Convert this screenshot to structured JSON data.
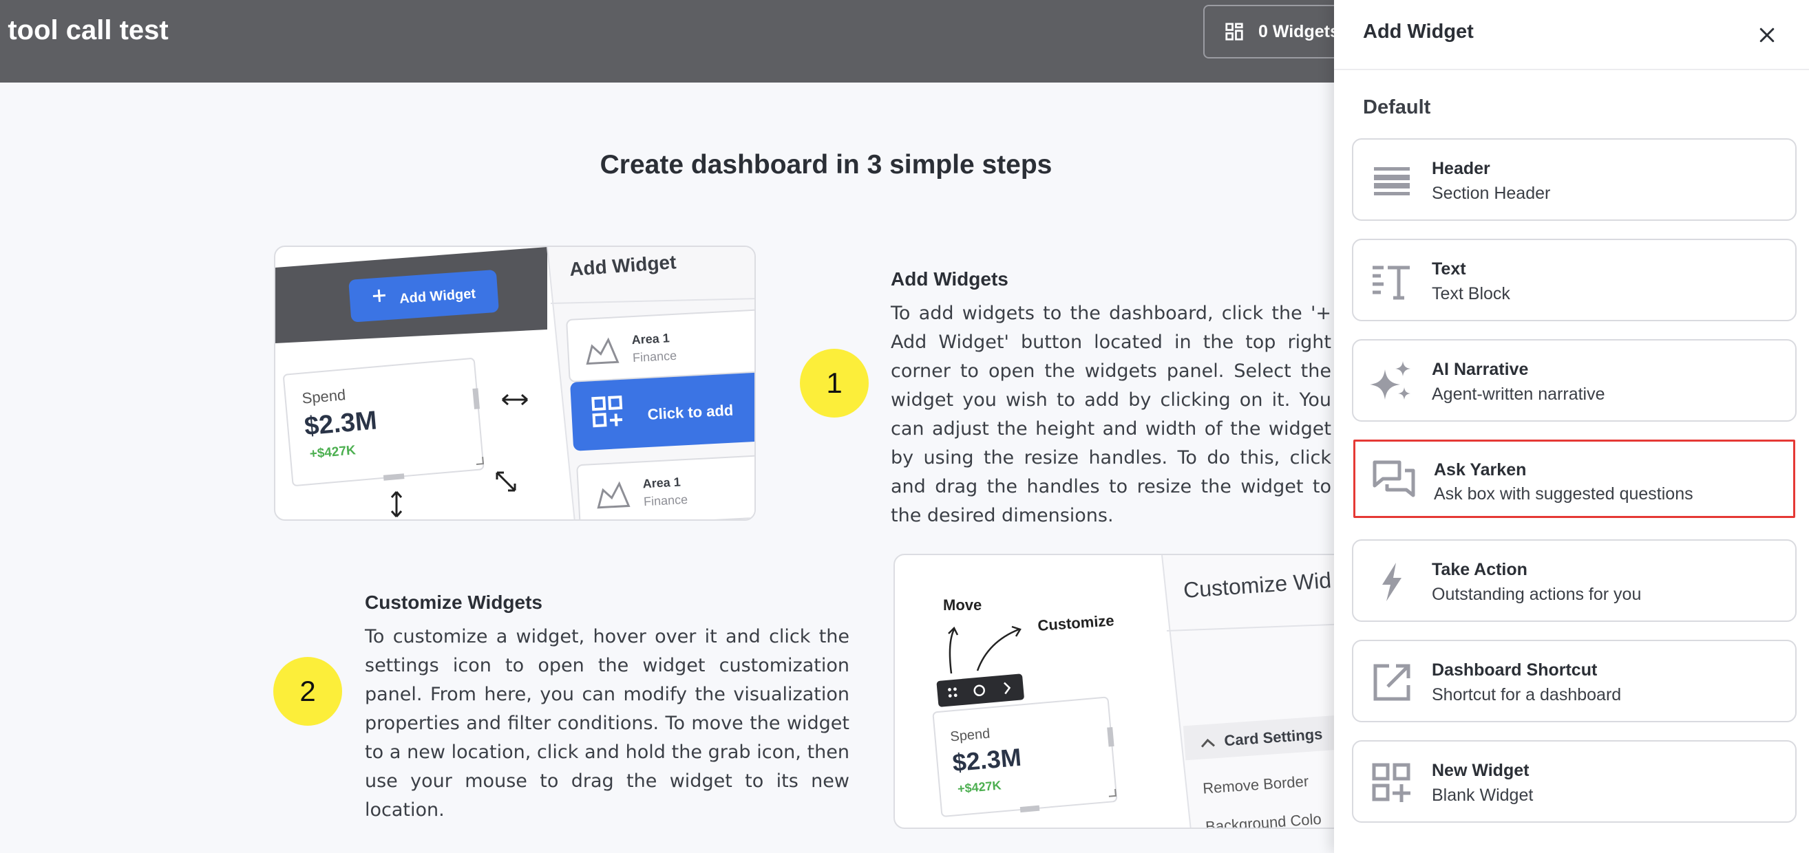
{
  "header": {
    "title": "e tool call test",
    "widgets_button": "0 Widgets"
  },
  "main": {
    "heading": "Create dashboard in 3 simple steps",
    "steps": [
      {
        "number": "1",
        "title": "Add Widgets",
        "body": "To add widgets to the dashboard, click the '+ Add Widget' button located in the top right corner to open the widgets panel. Select the widget you wish to add by clicking on it. You can adjust the height and width of the widget by using the resize handles. To do this, click and drag the handles to resize the widget to the desired dimensions."
      },
      {
        "number": "2",
        "title": "Customize Widgets",
        "body": "To customize a widget, hover over it and click the settings icon to open the widget customization panel. From here, you can modify the visualization properties and filter conditions. To move the widget to a new location, click and hold the grab icon, then use your mouse to drag the widget to its new location."
      }
    ],
    "illustration1": {
      "add_widget_button": "Add Widget",
      "panel_title": "Add Widget",
      "card_title": "Spend",
      "card_value": "$2.3M",
      "card_delta": "+$427K",
      "item1_title": "Area 1",
      "item1_sub": "Finance",
      "click_to_add": "Click to add",
      "item2_title": "Area 1",
      "item2_sub": "Finance"
    },
    "illustration2": {
      "move_label": "Move",
      "customize_label": "Customize",
      "panel_title": "Customize Wid",
      "card_settings": "Card Settings",
      "remove_border": "Remove Border",
      "background_color": "Background Colo",
      "card_title": "Spend",
      "card_value": "$2.3M",
      "card_delta": "+$427K"
    }
  },
  "panel": {
    "title": "Add Widget",
    "section": "Default",
    "items": [
      {
        "name": "Header",
        "desc": "Section Header",
        "icon": "section-header-icon"
      },
      {
        "name": "Text",
        "desc": "Text Block",
        "icon": "text-block-icon"
      },
      {
        "name": "AI Narrative",
        "desc": "Agent-written narrative",
        "icon": "sparkles-icon"
      },
      {
        "name": "Ask Yarken",
        "desc": "Ask box with suggested questions",
        "icon": "chat-bubbles-icon"
      },
      {
        "name": "Take Action",
        "desc": "Outstanding actions for you",
        "icon": "lightning-icon"
      },
      {
        "name": "Dashboard Shortcut",
        "desc": "Shortcut for a dashboard",
        "icon": "external-link-icon"
      },
      {
        "name": "New Widget",
        "desc": "Blank Widget",
        "icon": "widget-grid-add-icon"
      }
    ],
    "selected_index": 3,
    "colors": {
      "selected_border": "#e53935",
      "icon_gray": "#9a9ba4",
      "step_badge": "#fcee3a",
      "topbar": "#5e5f63",
      "primary_blue": "#3b74e4"
    }
  }
}
